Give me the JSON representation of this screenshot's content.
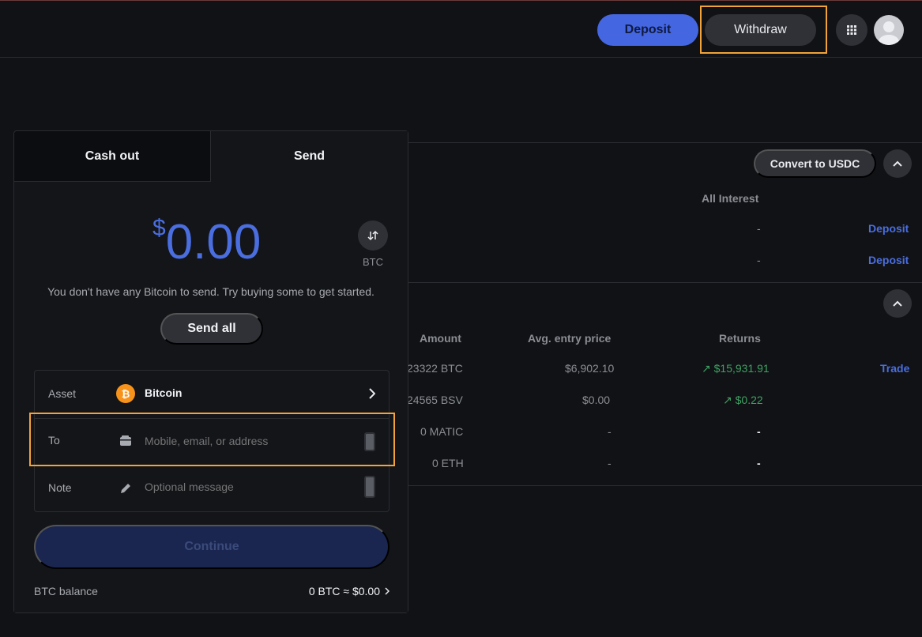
{
  "header": {
    "deposit_label": "Deposit",
    "withdraw_label": "Withdraw"
  },
  "portfolio": {
    "convert_label": "Convert to USDC",
    "cash_header": "All Interest",
    "cash_rows": [
      {
        "interest": "-",
        "action": "Deposit"
      },
      {
        "interest": "-",
        "action": "Deposit"
      }
    ],
    "columns": {
      "amount": "Amount",
      "entry": "Avg. entry price",
      "returns": "Returns"
    },
    "rows": [
      {
        "amount": "23322 BTC",
        "entry": "$6,902.10",
        "returns": "$15,931.91",
        "trend": "up",
        "action": "Trade"
      },
      {
        "amount": "24565 BSV",
        "entry": "$0.00",
        "returns": "$0.22",
        "trend": "up",
        "action": ""
      },
      {
        "amount": "0 MATIC",
        "entry": "-",
        "returns": "-",
        "trend": "",
        "action": ""
      },
      {
        "amount": "0 ETH",
        "entry": "-",
        "returns": "-",
        "trend": "",
        "action": ""
      }
    ]
  },
  "modal": {
    "tabs": {
      "cash_out": "Cash out",
      "send": "Send"
    },
    "amount": {
      "currency_symbol": "$",
      "value": "0.00"
    },
    "swap_unit": "BTC",
    "notice": "You don't have any Bitcoin to send. Try buying some to get started.",
    "send_all_label": "Send all",
    "form": {
      "asset_label": "Asset",
      "asset_value": "Bitcoin",
      "to_label": "To",
      "to_placeholder": "Mobile, email, or address",
      "note_label": "Note",
      "note_placeholder": "Optional message"
    },
    "continue_label": "Continue",
    "balance_label": "BTC balance",
    "balance_value": "0 BTC ≈ $0.00"
  },
  "colors": {
    "accent": "#4a6ee0",
    "background": "#111215",
    "bitcoin": "#f7931a",
    "positive": "#3fa164",
    "highlight": "#f2a33a"
  }
}
